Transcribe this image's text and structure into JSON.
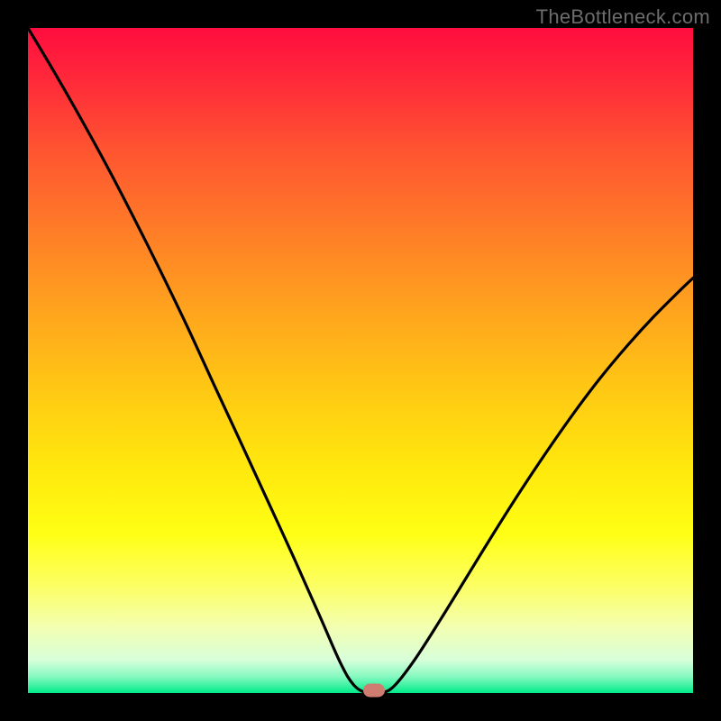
{
  "watermark": "TheBottleneck.com",
  "colors": {
    "frame": "#000000",
    "curve": "#000000",
    "marker": "#cf7d71",
    "gradient_top": "#ff0d3e",
    "gradient_bottom": "#00eb8a"
  },
  "chart_data": {
    "type": "line",
    "title": "",
    "xlabel": "",
    "ylabel": "",
    "xlim": [
      0,
      100
    ],
    "ylim": [
      0,
      100
    ],
    "grid": false,
    "legend": false,
    "series": [
      {
        "name": "bottleneck-curve",
        "x": [
          0,
          4,
          8,
          12,
          16,
          20,
          24,
          28,
          32,
          36,
          40,
          44,
          47,
          49,
          51,
          53,
          55,
          58,
          62,
          66,
          70,
          74,
          78,
          82,
          86,
          90,
          94,
          98,
          100
        ],
        "y": [
          100,
          93.3,
          86.3,
          79.0,
          71.3,
          63.3,
          55.0,
          46.3,
          37.7,
          29.0,
          20.3,
          11.3,
          4.5,
          1.2,
          0.0,
          0.0,
          1.0,
          4.8,
          11.0,
          17.5,
          24.0,
          30.3,
          36.3,
          42.0,
          47.3,
          52.1,
          56.5,
          60.5,
          62.4
        ]
      }
    ],
    "marker": {
      "x": 52,
      "y": 0.4
    },
    "note": "x and y are in percent of the inner plot area (origin bottom-left). Values are read off the rendered pixels; no axis labels are present in the image."
  }
}
